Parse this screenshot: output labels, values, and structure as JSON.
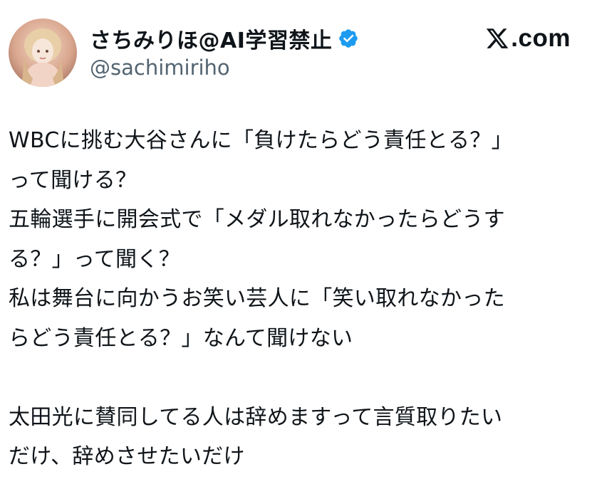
{
  "author": {
    "display_name": "さちみりほ@AI学習禁止",
    "handle": "@sachimiriho",
    "verified": true,
    "verified_icon": "verified-badge-icon",
    "verified_color": "#1d9bf0"
  },
  "brand": {
    "text": ".com",
    "icon": "x-logo-icon"
  },
  "tweet": {
    "lines": [
      "WBCに挑む大谷さんに「負けたらどう責任とる？」",
      "って聞ける？",
      "五輪選手に開会式で「メダル取れなかったらどうす",
      "る？」って聞く？",
      "私は舞台に向かうお笑い芸人に「笑い取れなかった",
      "らどう責任とる？」なんて聞けない",
      "",
      "太田光に賛同してる人は辞めますって言質取りたい",
      "だけ、辞めさせたいだけ"
    ]
  },
  "colors": {
    "text": "#0f1419",
    "secondary_text": "#536471",
    "background": "#ffffff"
  }
}
